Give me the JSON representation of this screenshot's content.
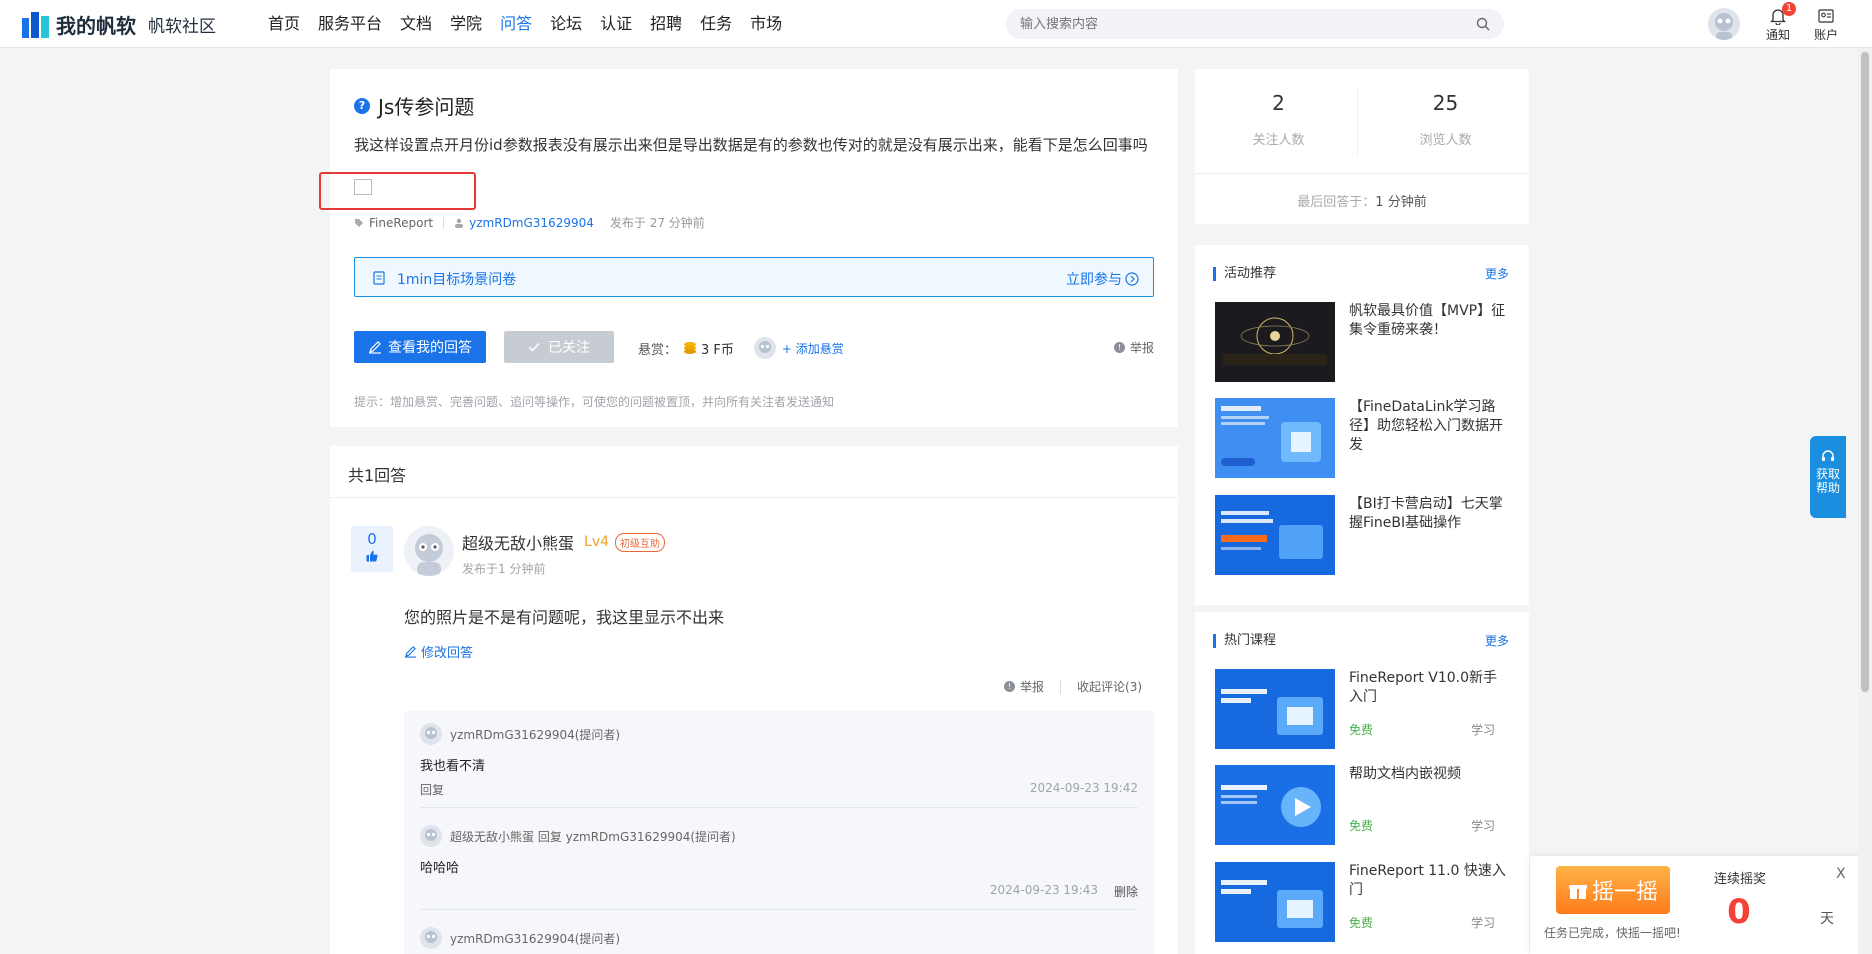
{
  "brand": {
    "name": "我的帆软",
    "community": "帆软社区"
  },
  "nav": [
    {
      "label": "首页",
      "active": false
    },
    {
      "label": "服务平台",
      "active": false
    },
    {
      "label": "文档",
      "active": false
    },
    {
      "label": "学院",
      "active": false
    },
    {
      "label": "问答",
      "active": true
    },
    {
      "label": "论坛",
      "active": false
    },
    {
      "label": "认证",
      "active": false
    },
    {
      "label": "招聘",
      "active": false
    },
    {
      "label": "任务",
      "active": false
    },
    {
      "label": "市场",
      "active": false
    }
  ],
  "search": {
    "placeholder": "输入搜索内容"
  },
  "topbar": {
    "notice_label": "通知",
    "notice_count": "1",
    "account_label": "账户"
  },
  "question": {
    "title": "Js传参问题",
    "body": "我这样设置点开月份id参数报表没有展示出来但是导出数据是有的参数也传对的就是没有展示出来，能看下是怎么回事吗",
    "tag": "FineReport",
    "author": "yzmRDmG31629904",
    "posted": "发布于 27 分钟前",
    "survey_label": "1min目标场景问卷",
    "survey_join": "立即参与",
    "my_answer_btn": "查看我的回答",
    "followed_btn": "已关注",
    "reward_label": "悬赏：",
    "reward_amount": "3 F币",
    "add_reward": "+ 添加悬赏",
    "report": "举报",
    "tip": "提示：增加悬赏、完善问题、追问等操作，可使您的问题被置顶，并向所有关注者发送通知"
  },
  "answers": {
    "count_label": "共1回答",
    "items": [
      {
        "votes": "0",
        "name": "超级无敌小熊蛋",
        "level": "Lv4",
        "level_badge": "初级互助",
        "time": "发布于1 分钟前",
        "body": "您的照片是不是有问题呢，我这里显示不出来",
        "edit": "修改回答",
        "report": "举报",
        "collapse": "收起评论(3)",
        "comments": [
          {
            "head": "yzmRDmG31629904(提问者)",
            "text": "我也看不清",
            "reply": "回复",
            "time": "2024-09-23 19:42"
          },
          {
            "head": "超级无敌小熊蛋 回复 yzmRDmG31629904(提问者)",
            "text": "哈哈哈",
            "time": "2024-09-23 19:43",
            "del": "删除"
          },
          {
            "head": "yzmRDmG31629904(提问者)"
          }
        ]
      }
    ]
  },
  "stats": {
    "followers": "2",
    "followers_label": "关注人数",
    "views": "25",
    "views_label": "浏览人数",
    "last_reply_label": "最后回答于：",
    "last_reply_value": "1 分钟前"
  },
  "activities": {
    "title": "活动推荐",
    "more": "更多",
    "items": [
      {
        "text": "帆软最具价值【MVP】征集令重磅来袭！"
      },
      {
        "text": "【FineDataLink学习路径】助您轻松入门数据开发"
      },
      {
        "text": "【BI打卡营启动】七天掌握FineBI基础操作"
      }
    ]
  },
  "courses": {
    "title": "热门课程",
    "more": "更多",
    "items": [
      {
        "text": "FineReport V10.0新手入门",
        "free": "免费",
        "study": "学习"
      },
      {
        "text": "帮助文档内嵌视频",
        "free": "免费",
        "study": "学习"
      },
      {
        "text": "FineReport 11.0 快速入门",
        "free": "免费",
        "study": "学习"
      }
    ]
  },
  "help_float": {
    "line1": "获取",
    "line2": "帮助"
  },
  "shake": {
    "button": "摇一摇",
    "note": "任务已完成，快摇一摇吧!",
    "title": "连续摇奖",
    "close": "X",
    "days": "0",
    "unit": "天"
  },
  "colors": {
    "accent": "#1a73e8",
    "danger": "#e53935",
    "free": "#4caf50"
  }
}
